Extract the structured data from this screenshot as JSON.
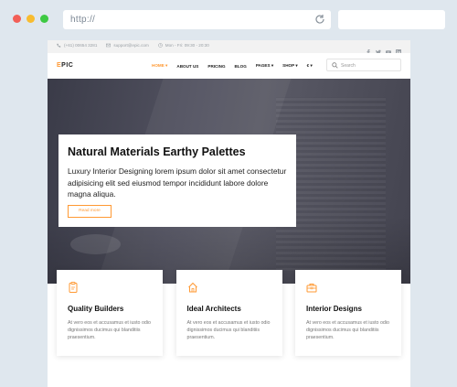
{
  "browser": {
    "url": "http://",
    "search_value": ""
  },
  "topbar": {
    "phone": "(+61) 00654 3281",
    "email": "support@epic.com",
    "hours": "Mon - Fri: 09:30 - 20:30",
    "social_icons": [
      "facebook-icon",
      "twitter-icon",
      "youtube-icon",
      "linkedin-icon"
    ]
  },
  "nav": {
    "logo_mark": "E",
    "logo_rest": "PIC",
    "items": [
      {
        "label": "HOME ▾",
        "active": true
      },
      {
        "label": "ABOUT US",
        "active": false
      },
      {
        "label": "PRICING",
        "active": false
      },
      {
        "label": "BLOG",
        "active": false
      },
      {
        "label": "PAGES ▾",
        "active": false
      },
      {
        "label": "SHOP ▾",
        "active": false
      },
      {
        "label": "€ ▾",
        "active": false
      }
    ],
    "search_placeholder": "Search"
  },
  "hero": {
    "title": "Natural Materials Earthy Palettes",
    "text": "Luxury Interior Designing lorem ipsum dolor sit amet consectetur adipisicing elit sed eiusmod tempor incididunt labore dolore magna aliqua.",
    "button": "Read more"
  },
  "features": [
    {
      "icon": "clipboard-icon",
      "title": "Quality Builders",
      "text": "At vero eos et accusamus et iusto odio dignissimos ducimus qui blanditiis praesentium."
    },
    {
      "icon": "house-icon",
      "title": "Ideal Architects",
      "text": "At vero eos et accusamus et iusto odio dignissimos ducimus qui blanditiis praesentium."
    },
    {
      "icon": "toolbox-icon",
      "title": "Interior Designs",
      "text": "At vero eos et accusamus et iusto odio dignissimos ducimus qui blanditiis praesentium."
    }
  ],
  "colors": {
    "accent": "#ff9933",
    "chrome_bg": "#dfe7ee",
    "topbar_bg": "#f2f2f2",
    "hero_overlay": "#45454f"
  }
}
